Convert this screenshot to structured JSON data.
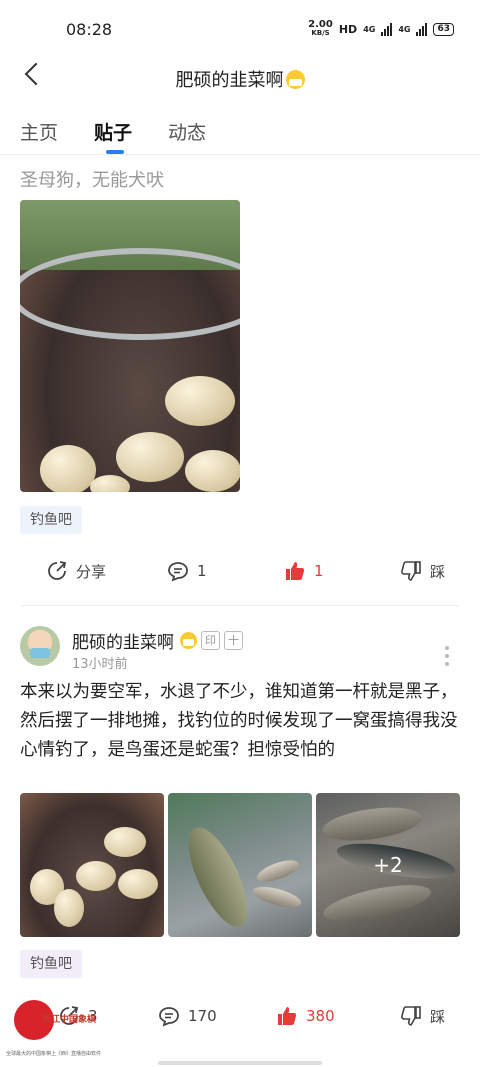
{
  "status": {
    "time": "08:28",
    "net_speed": "2.00",
    "net_unit": "KB/S",
    "hd": "HD",
    "net1": "4G",
    "net2": "4G",
    "battery": "63"
  },
  "nav": {
    "title": "肥硕的韭菜啊"
  },
  "tabs": [
    {
      "label": "主页"
    },
    {
      "label": "贴子"
    },
    {
      "label": "动态"
    }
  ],
  "post1": {
    "text": "圣母狗，无能犬吠",
    "tag": "钓鱼吧",
    "share_label": "分享",
    "comments": "1",
    "likes": "1",
    "dislike_label": "踩"
  },
  "post2": {
    "author": "肥硕的韭菜啊",
    "badge1": "印",
    "badge2": "十",
    "time": "13小时前",
    "body": "本来以为要空军，水退了不少，谁知道第一杆就是黑子，然后摆了一排地摊，找钓位的时候发现了一窝蛋搞得我没心情钓了，是鸟蛋还是蛇蛋？担惊受怕的",
    "more_count": "+2",
    "tag": "钓鱼吧",
    "shares": "3",
    "comments": "170",
    "likes": "380",
    "dislike_label": "踩"
  },
  "watermark": {
    "text": "西江中国象棋",
    "sub": "全球最大的中国象棋上《西》直播自由软件"
  },
  "colors": {
    "accent": "#2a7ff0",
    "like": "#e63b3b"
  }
}
